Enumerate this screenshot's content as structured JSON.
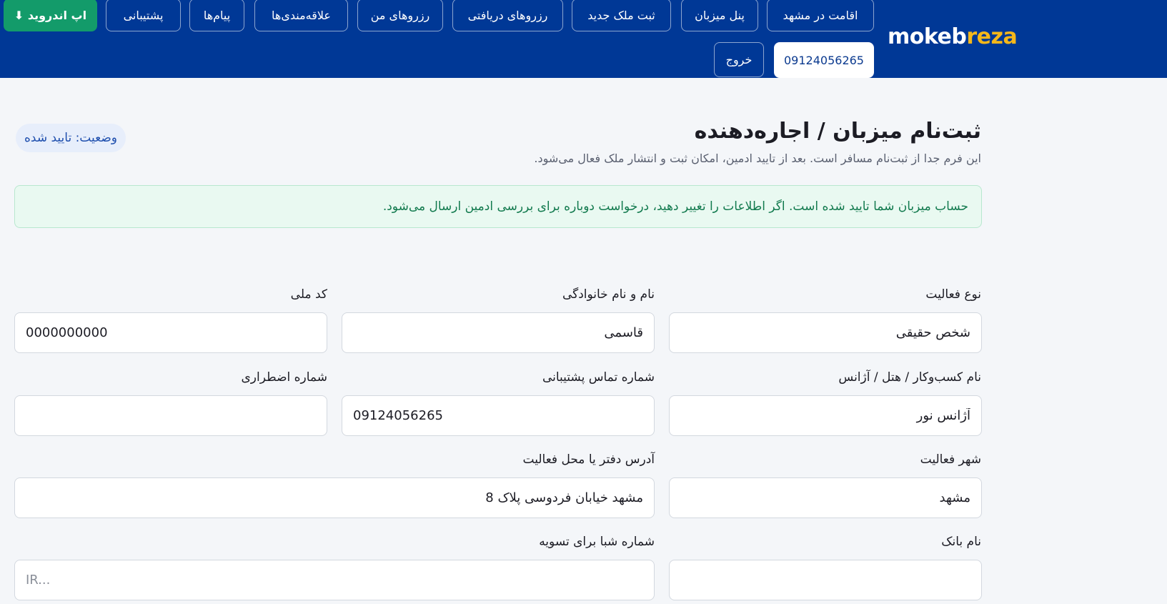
{
  "brand": {
    "logo_part1": "mokeb",
    "logo_part2": "reza"
  },
  "nav": {
    "android_app": "⬇ اپ اندروید",
    "support": "پشتیبانی",
    "messages": "پیام‌ها",
    "favorites": "علاقه‌مندی‌ها",
    "my_reservations": "رزروهای من",
    "received_reservations": "رزروهای دریافتی",
    "register_property": "ثبت ملک جدید",
    "host_panel": "پنل میزبان",
    "stay_in_mashhad": "اقامت در مشهد",
    "user_phone": "09124056265",
    "logout": "خروج"
  },
  "page": {
    "title": "ثبت‌نام میزبان / اجاره‌دهنده",
    "subtitle": "این فرم جدا از ثبت‌نام مسافر است. بعد از تایید ادمین، امکان ثبت و انتشار ملک فعال می‌شود.",
    "status": "وضعیت: تایید شده",
    "alert": "حساب میزبان شما تایید شده است. اگر اطلاعات را تغییر دهید، درخواست دوباره برای بررسی ادمین ارسال می‌شود."
  },
  "form": {
    "activity_type": {
      "label": "نوع فعالیت",
      "value": "شخص حقیقی"
    },
    "full_name": {
      "label": "نام و نام خانوادگی",
      "value": "قاسمی"
    },
    "national_code": {
      "label": "کد ملی",
      "value": "0000000000"
    },
    "business_name": {
      "label": "نام کسب‌وکار / هتل / آژانس",
      "value": "آژانس نور"
    },
    "support_phone": {
      "label": "شماره تماس پشتیبانی",
      "value": "09124056265"
    },
    "emergency_phone": {
      "label": "شماره اضطراری",
      "value": ""
    },
    "city": {
      "label": "شهر فعالیت",
      "value": "مشهد"
    },
    "address": {
      "label": "آدرس دفتر یا محل فعالیت",
      "value": "مشهد خیابان فردوسی پلاک 8"
    },
    "bank_name": {
      "label": "نام بانک",
      "value": ""
    },
    "sheba": {
      "label": "شماره شبا برای تسویه",
      "value": "",
      "placeholder": "IR..."
    }
  }
}
